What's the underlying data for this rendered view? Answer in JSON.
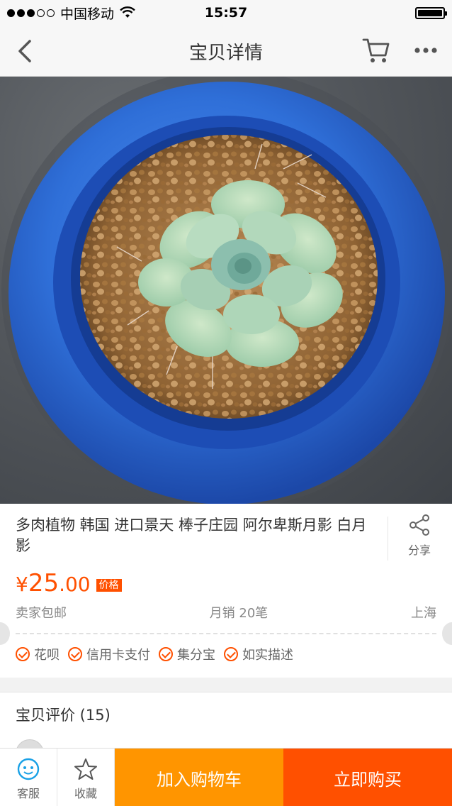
{
  "status_bar": {
    "carrier": "中国移动",
    "time": "15:57",
    "battery_level": 1.0
  },
  "nav": {
    "title": "宝贝详情"
  },
  "product": {
    "title": "多肉植物 韩国 进口景天 棒子庄园  阿尔卑斯月影 白月影",
    "share_label": "分享",
    "currency": "¥",
    "price_int": "25",
    "price_dec": ".00",
    "price_tag": "价格",
    "shipping": "卖家包邮",
    "monthly_sales": "月销 20笔",
    "location": "上海",
    "services": [
      "花呗",
      "信用卡支付",
      "集分宝",
      "如实描述"
    ]
  },
  "reviews": {
    "title": "宝贝评价 (15)"
  },
  "bottom_bar": {
    "service_label": "客服",
    "favorite_label": "收藏",
    "add_cart_label": "加入购物车",
    "buy_now_label": "立即购买"
  },
  "colors": {
    "accent": "#ff5000",
    "cart": "#ff9500",
    "pot_blue": "#2f6fd8"
  }
}
